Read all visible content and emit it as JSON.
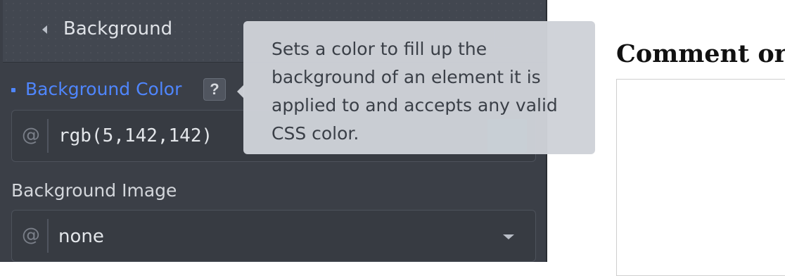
{
  "panel": {
    "header_title": "Background",
    "background_color_label": "Background Color",
    "help_label": "?",
    "color_value": "rgb(5,142,142)",
    "swatch_color": "#058e8e",
    "background_image_label": "Background Image",
    "image_value": "none",
    "at_symbol": "@",
    "accent_color": "#4f86ff"
  },
  "tooltip": {
    "text": "Sets a color to fill up the background of an element it is applied to and accepts any valid CSS color."
  },
  "page": {
    "heading": "Comment or"
  }
}
